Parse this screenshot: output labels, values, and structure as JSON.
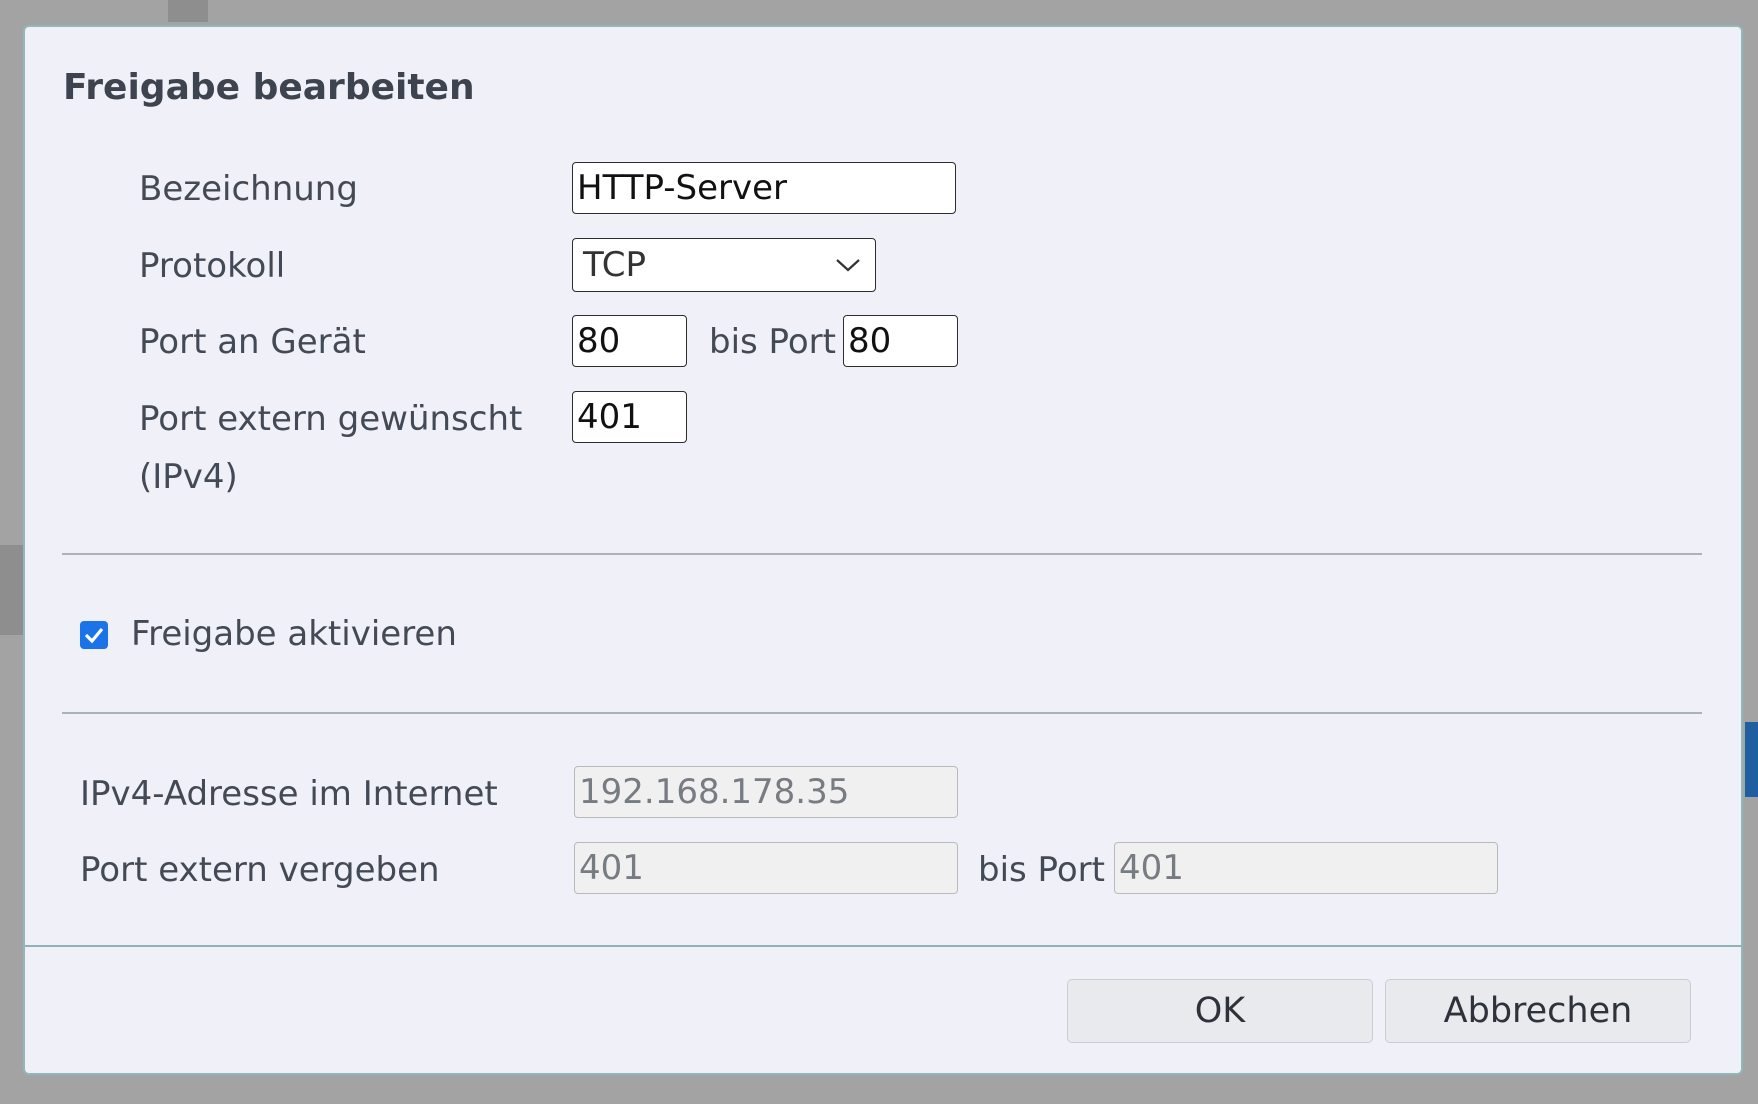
{
  "dialog": {
    "title": "Freigabe bearbeiten"
  },
  "form": {
    "bezeichnung_label": "Bezeichnung",
    "bezeichnung_value": "HTTP-Server",
    "protokoll_label": "Protokoll",
    "protokoll_value": "TCP",
    "port_geraet_label": "Port an Gerät",
    "port_geraet_from": "80",
    "bis_port_label": "bis Port",
    "port_geraet_to": "80",
    "port_extern_gewuenscht_label_line1": "Port extern gewünscht",
    "port_extern_gewuenscht_label_line2": "(IPv4)",
    "port_extern_gewuenscht_value": "401"
  },
  "activation": {
    "checkbox_label": "Freigabe aktivieren",
    "checked": true
  },
  "info": {
    "ipv4_label": "IPv4-Adresse im Internet",
    "ipv4_value": "192.168.178.35",
    "port_extern_vergeben_label": "Port extern vergeben",
    "port_extern_vergeben_from": "401",
    "bis_port_label": "bis Port",
    "port_extern_vergeben_to": "401"
  },
  "buttons": {
    "ok_label": "OK",
    "cancel_label": "Abbrechen"
  },
  "colors": {
    "dialog_bg": "#f0f1f8",
    "checkbox_accent": "#1a73e8",
    "dialog_border": "#8fb8b8"
  }
}
